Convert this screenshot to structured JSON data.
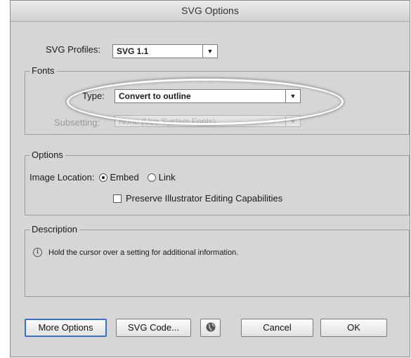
{
  "window": {
    "title": "SVG Options"
  },
  "profiles": {
    "label": "SVG Profiles:",
    "value": "SVG 1.1"
  },
  "fonts": {
    "legend": "Fonts",
    "type_label": "Type:",
    "type_value": "Convert to outline",
    "subsetting_label": "Subsetting:",
    "subsetting_value": "None (Use System Fonts)"
  },
  "options": {
    "legend": "Options",
    "image_location_label": "Image Location:",
    "embed_label": "Embed",
    "link_label": "Link",
    "embed_selected": true,
    "preserve_label": "Preserve Illustrator Editing Capabilities",
    "preserve_checked": false
  },
  "description": {
    "legend": "Description",
    "text": "Hold the cursor over a setting for additional information."
  },
  "buttons": {
    "more_options": "More Options",
    "svg_code": "SVG Code...",
    "cancel": "Cancel",
    "ok": "OK"
  },
  "icons": {
    "dropdown_arrow": "chevron-down-icon",
    "info": "info-icon",
    "browser_preview": "globe-icon"
  }
}
